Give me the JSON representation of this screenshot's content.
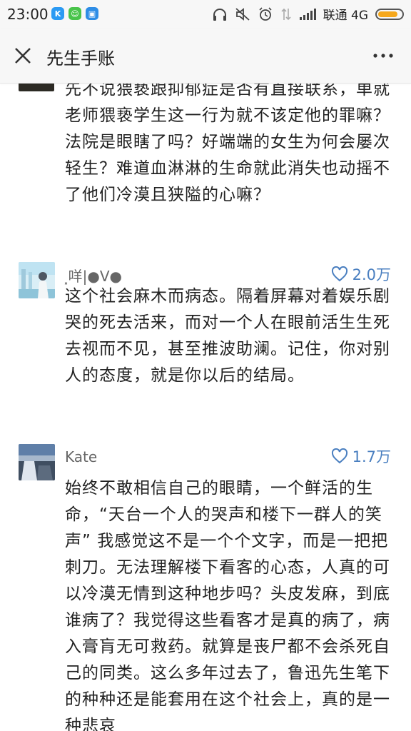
{
  "status_bar": {
    "time": "23:00",
    "carrier": "联通 4G",
    "battery_level": 0.85,
    "app_icons": [
      {
        "name": "k-app-icon",
        "glyph": "K",
        "color": "#2b9af3"
      },
      {
        "name": "wechat-mini-icon",
        "glyph": "☺",
        "color": "#49c44b"
      },
      {
        "name": "square-app-icon",
        "glyph": "▣",
        "color": "#2e8de6"
      }
    ]
  },
  "nav": {
    "title": "先生手账"
  },
  "previous_comment": {
    "text": "先不说猥亵跟抑郁症是否有直接联系，单就老师猥亵学生这一行为就不该定他的罪嘛？法院是眼瞎了吗？好端端的女生为何会屡次轻生？难道血淋淋的生命就此消失也动摇不了他们冷漠且狭隘的心嘛？"
  },
  "comments": [
    {
      "username": "⸼咩|●V●",
      "likes": "2.0万",
      "text": "这个社会麻木而病态。隔着屏幕对着娱乐剧哭的死去活来，而对一个人在眼前活生生死去视而不见，甚至推波助澜。记住，你对别人的态度，就是你以后的结局。"
    },
    {
      "username": "Kate",
      "likes": "1.7万",
      "text": "始终不敢相信自己的眼睛，一个鲜活的生命，“天台一个人的哭声和楼下一群人的笑声” 我感觉这不是一个个文字，而是一把把刺刀。无法理解楼下看客的心态，人真的可以冷漠无情到这种地步吗？头皮发麻，到底谁病了？我觉得这些看客才是真的病了，病入膏肓无可救药。就算是丧尸都不会杀死自己的同类。这么多年过去了，鲁迅先生笔下的种种还是能套用在这个社会上，真的是一种悲哀"
    }
  ],
  "colors": {
    "accent": "#4a7fc0",
    "battery": "#f6a81c"
  }
}
